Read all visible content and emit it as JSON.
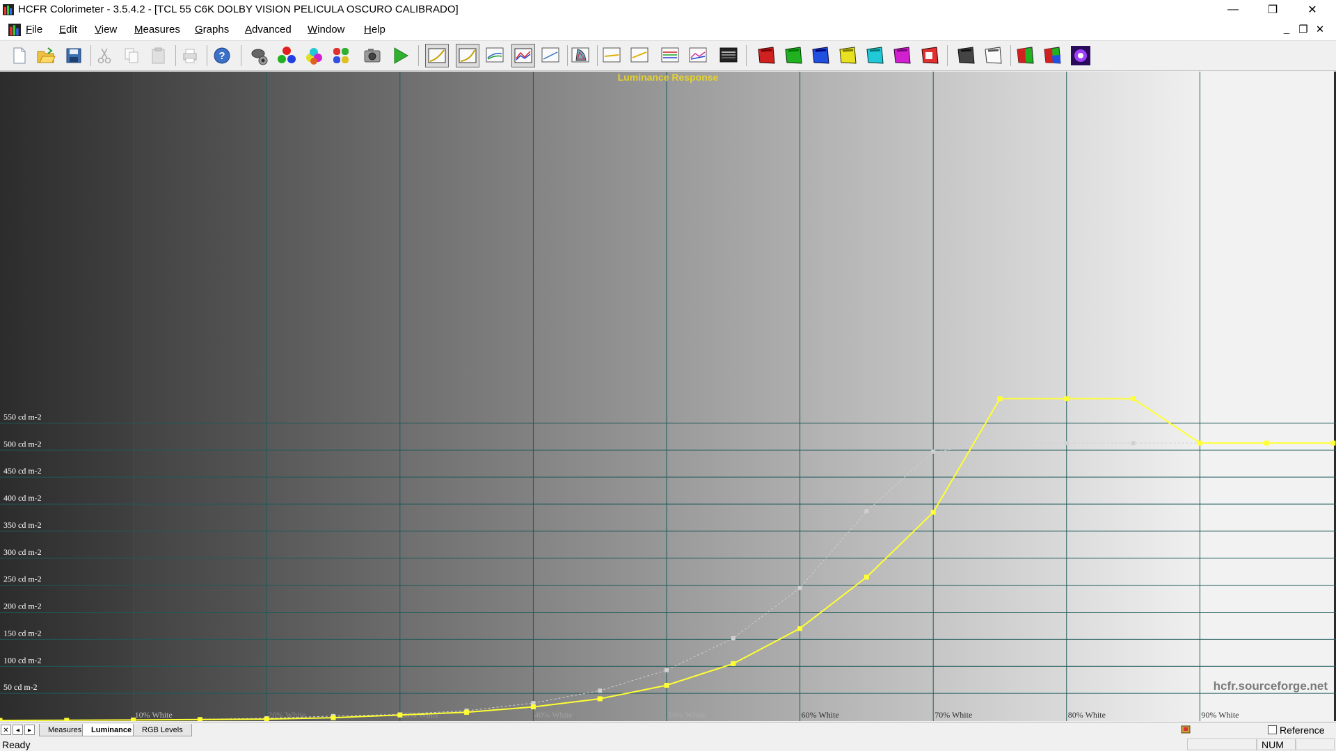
{
  "window": {
    "title": "HCFR Colorimeter - 3.5.4.2 - [TCL 55 C6K DOLBY VISION PELICULA OSCURO CALIBRADO]",
    "minimize_glyph": "—",
    "maximize_glyph": "❐",
    "close_glyph": "✕"
  },
  "menu": {
    "items": [
      {
        "label": "File",
        "ul": "F",
        "rest": "ile"
      },
      {
        "label": "Edit",
        "ul": "E",
        "rest": "dit"
      },
      {
        "label": "View",
        "ul": "V",
        "rest": "iew"
      },
      {
        "label": "Measures",
        "ul": "M",
        "rest": "easures"
      },
      {
        "label": "Graphs",
        "ul": "G",
        "rest": "raphs"
      },
      {
        "label": "Advanced",
        "ul": "A",
        "rest": "dvanced"
      },
      {
        "label": "Window",
        "ul": "W",
        "rest": "indow"
      },
      {
        "label": "Help",
        "ul": "H",
        "rest": "elp"
      }
    ],
    "mdi_minimize": "_",
    "mdi_restore": "❐",
    "mdi_close": "✕"
  },
  "toolbar": {
    "buttons": [
      "new-document-icon",
      "open-folder-icon",
      "save-disk-icon",
      "cut-scissors-icon",
      "copy-icon",
      "paste-icon",
      "print-icon",
      "help-icon",
      "sensor-probe-icon",
      "primary-colors-icon",
      "secondary-colors-icon",
      "all-colors-icon",
      "camera-icon",
      "play-continuous-icon",
      "graph-luminance-icon",
      "graph-gamma-icon",
      "graph-rgb-icon",
      "graph-luminance-response-icon",
      "graph-saturation-icon",
      "cie-chart-icon",
      "graph-color-temp-icon",
      "graph-deltae-icon",
      "graph-rgb-levels-icon",
      "graph-near-black-icon",
      "graph-near-white-icon",
      "measure-red-icon",
      "measure-green-icon",
      "measure-blue-icon",
      "measure-yellow-icon",
      "measure-cyan-icon",
      "measure-magenta-icon",
      "measure-red-sat-icon",
      "measure-gray-icon",
      "measure-contrast-icon",
      "measure-rgb-icon",
      "measure-rgb-alt-icon",
      "special-glow-icon"
    ]
  },
  "chart_data": {
    "type": "line",
    "title": "Luminance Response",
    "ylabel_unit": "cd m-2",
    "ylim": [
      0,
      600
    ],
    "y_ticks": [
      {
        "value": 50,
        "label": "50 cd m-2"
      },
      {
        "value": 100,
        "label": "100 cd m-2"
      },
      {
        "value": 150,
        "label": "150 cd m-2"
      },
      {
        "value": 200,
        "label": "200 cd m-2"
      },
      {
        "value": 250,
        "label": "250 cd m-2"
      },
      {
        "value": 300,
        "label": "300 cd m-2"
      },
      {
        "value": 350,
        "label": "350 cd m-2"
      },
      {
        "value": 400,
        "label": "400 cd m-2"
      },
      {
        "value": 450,
        "label": "450 cd m-2"
      },
      {
        "value": 500,
        "label": "500 cd m-2"
      },
      {
        "value": 550,
        "label": "550 cd m-2"
      }
    ],
    "xlim": [
      0,
      100
    ],
    "x_ticks": [
      {
        "value": 10,
        "label": "10% White"
      },
      {
        "value": 20,
        "label": "20% White"
      },
      {
        "value": 30,
        "label": "30% White"
      },
      {
        "value": 40,
        "label": "40% White"
      },
      {
        "value": 50,
        "label": "50% White"
      },
      {
        "value": 60,
        "label": "60% White"
      },
      {
        "value": 70,
        "label": "70% White"
      },
      {
        "value": 80,
        "label": "80% White"
      },
      {
        "value": 90,
        "label": "90% White"
      }
    ],
    "grid": true,
    "series": [
      {
        "style": "measured",
        "color": "#ffff33",
        "x": [
          0,
          5,
          10,
          15,
          20,
          25,
          30,
          35,
          40,
          45,
          50,
          55,
          60,
          65,
          70,
          75,
          80,
          85,
          90,
          95,
          100
        ],
        "y": [
          0,
          0.2,
          0.8,
          1.5,
          2.5,
          5,
          10,
          15,
          25,
          40,
          65,
          105,
          170,
          265,
          385,
          595,
          595,
          595,
          513,
          513,
          513
        ]
      },
      {
        "style": "reference",
        "color": "#d0d0d0",
        "x": [
          0,
          5,
          10,
          15,
          20,
          25,
          30,
          35,
          40,
          45,
          50,
          55,
          60,
          65,
          70,
          75,
          80,
          85,
          90,
          95,
          100
        ],
        "y": [
          0,
          0.2,
          0.8,
          2,
          4,
          8,
          11,
          18,
          32,
          55,
          93,
          152,
          245,
          387,
          497,
          513,
          513,
          513,
          513,
          513,
          513
        ]
      }
    ]
  },
  "watermark": "hcfr.sourceforge.net",
  "sheet_tabs": {
    "nav": [
      "✕",
      "◂",
      "▸",
      "▸"
    ],
    "tabs": [
      {
        "label": "Measures",
        "active": false
      },
      {
        "label": "Luminance",
        "active": true
      },
      {
        "label": "RGB Levels",
        "active": false
      }
    ],
    "reference_label": "Reference"
  },
  "status": {
    "text": "Ready",
    "num": "NUM"
  }
}
